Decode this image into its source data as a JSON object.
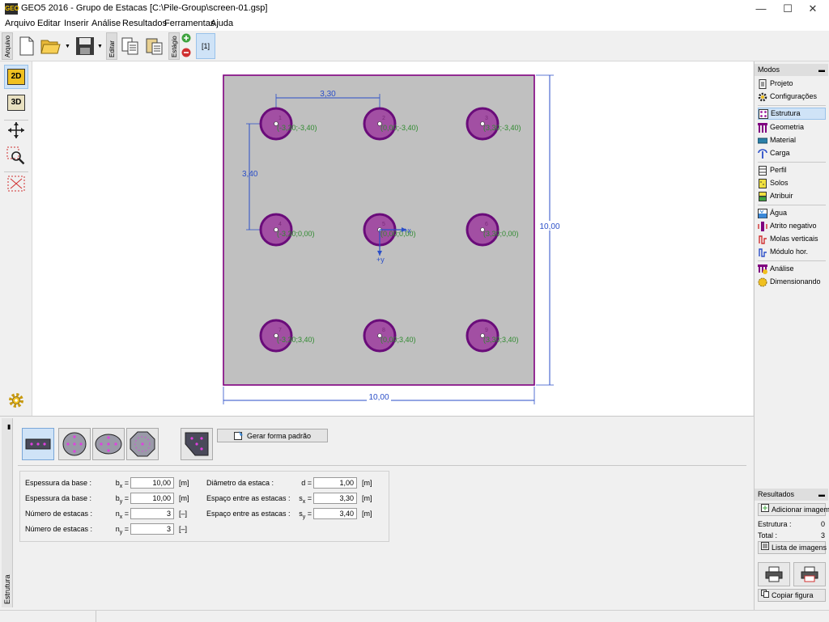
{
  "window": {
    "title": "GEO5 2016 - Grupo de Estacas [C:\\Pile-Group\\screen-01.gsp]",
    "icon_text": "GEO",
    "minimize": "—",
    "maximize": "☐",
    "close": "✕"
  },
  "menu": [
    "Arquivo",
    "Editar",
    "Inserir",
    "Análise",
    "Resultados",
    "Ferramentas",
    "Ajuda"
  ],
  "toolbar": {
    "arquivo_tab": "Arquivo",
    "editar_tab": "Editar",
    "estagio_tab": "Estágio",
    "stage_label": "[1]"
  },
  "left_tools": {
    "view_2d": "2D",
    "view_3d": "3D"
  },
  "drawing": {
    "dim_top": "3,30",
    "dim_left": "3,40",
    "dim_right": "10,00",
    "dim_bottom": "10,00",
    "axis_x": "+x",
    "axis_y": "+y",
    "piles": [
      {
        "num": "1",
        "coord": "(-3,30;-3,40)"
      },
      {
        "num": "2",
        "coord": "(0,00;-3,40)"
      },
      {
        "num": "3",
        "coord": "(3,30;-3,40)"
      },
      {
        "num": "4",
        "coord": "(-3,30;0,00)"
      },
      {
        "num": "5",
        "coord": "(0,00;0,00)"
      },
      {
        "num": "6",
        "coord": "(3,30;0,00)"
      },
      {
        "num": "7",
        "coord": "(-3,30;3,40)"
      },
      {
        "num": "8",
        "coord": "(0,00;3,40)"
      },
      {
        "num": "9",
        "coord": "(3,30;3,40)"
      }
    ]
  },
  "modes": {
    "header": "Modos",
    "collapse": "▬",
    "items": [
      "Projeto",
      "Configurações",
      "Estrutura",
      "Geometria",
      "Material",
      "Carga",
      "Perfil",
      "Solos",
      "Atribuir",
      "Água",
      "Atrito negativo",
      "Molas verticais",
      "Módulo hor.",
      "Análise",
      "Dimensionando"
    ]
  },
  "results": {
    "header": "Resultados",
    "collapse": "▬",
    "add_image": "Adicionar imagem",
    "estrutura_label": "Estrutura :",
    "estrutura_value": "0",
    "total_label": "Total :",
    "total_value": "3",
    "image_list": "Lista de imagens",
    "copy_figure": "Copiar figura"
  },
  "bottom": {
    "vtab": "Estrutura",
    "generate_button": "Gerar forma padrão",
    "fields": {
      "bx": {
        "label": "Espessura da base :",
        "sym": "b",
        "sub": "x",
        "value": "10,00",
        "unit": "[m]"
      },
      "by": {
        "label": "Espessura da base :",
        "sym": "b",
        "sub": "y",
        "value": "10,00",
        "unit": "[m]"
      },
      "nx": {
        "label": "Número de estacas :",
        "sym": "n",
        "sub": "x",
        "value": "3",
        "unit": "[–]"
      },
      "ny": {
        "label": "Número de estacas :",
        "sym": "n",
        "sub": "y",
        "value": "3",
        "unit": "[–]"
      },
      "d": {
        "label": "Diâmetro da estaca :",
        "sym": "d",
        "sub": "",
        "value": "1,00",
        "unit": "[m]"
      },
      "sx": {
        "label": "Espaço entre as estacas :",
        "sym": "s",
        "sub": "x",
        "value": "3,30",
        "unit": "[m]"
      },
      "sy": {
        "label": "Espaço entre as estacas :",
        "sym": "s",
        "sub": "y",
        "value": "3,40",
        "unit": "[m]"
      }
    },
    "equals": "="
  },
  "colors": {
    "pile_fill": "#a24fa3",
    "pile_ring": "#6a0c7a",
    "base_fill": "#c0c0c0",
    "base_border": "#800080",
    "dimension": "#2a4ec8",
    "coord_text": "#2f8a2f",
    "active_mode": "#cfe3f7"
  }
}
